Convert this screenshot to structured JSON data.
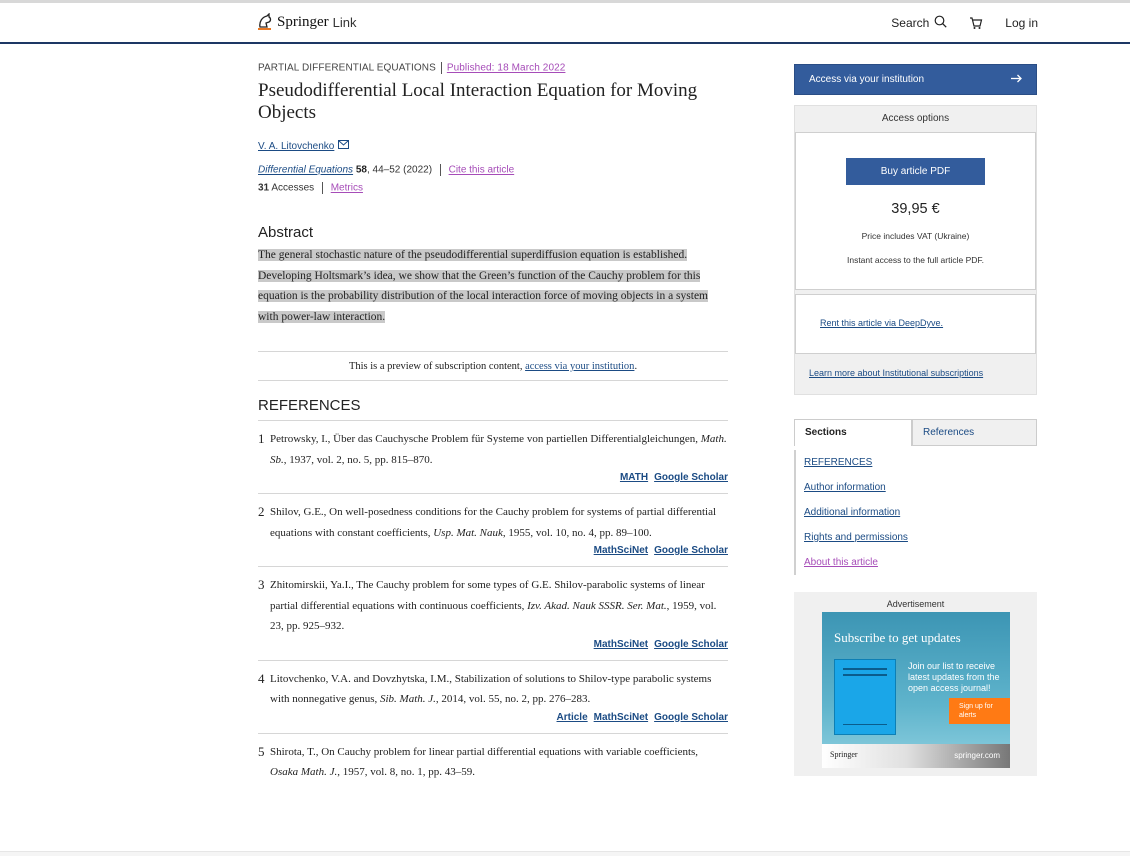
{
  "header": {
    "logo_text": "Springer",
    "logo_link": "Link",
    "search_label": "Search",
    "login_label": "Log in"
  },
  "article": {
    "section": "PARTIAL DIFFERENTIAL EQUATIONS",
    "published": "Published: 18 March 2022",
    "title": "Pseudodifferential Local Interaction Equation for Moving Objects",
    "author": "V. A. Litovchenko",
    "journal": "Differential Equations",
    "volume": "58",
    "pages": ", 44–52 (2022)",
    "cite": "Cite this article",
    "accesses_count": "31",
    "accesses_label": "Accesses",
    "metrics": "Metrics"
  },
  "abstract": {
    "heading": "Abstract",
    "text": "The general stochastic nature of the pseudodifferential superdiffusion equation is established. Developing Holtsmark’s idea, we show that the Green’s function of the Cauchy problem for this equation is the probability distribution of the local interaction force of moving objects in a system with power-law interaction."
  },
  "preview": {
    "prefix": "This is a preview of subscription content, ",
    "link": "access via your institution",
    "suffix": "."
  },
  "references": {
    "heading": "REFERENCES",
    "items": [
      {
        "num": "1",
        "pre": "Petrowsky, I., Über das Cauchysche Problem für Systeme von partiellen Differentialgleichungen, ",
        "source": "Math. Sb.",
        "post": ", 1937, vol. 2, no. 5, pp. 815–870.",
        "links": [
          "MATH",
          "Google Scholar"
        ]
      },
      {
        "num": "2",
        "pre": "Shilov, G.E., On well-posedness conditions for the Cauchy problem for systems of partial differential equations with constant coefficients, ",
        "source": "Usp. Mat. Nauk",
        "post": ", 1955, vol. 10, no. 4, pp. 89–100.",
        "links": [
          "MathSciNet",
          "Google Scholar"
        ]
      },
      {
        "num": "3",
        "pre": "Zhitomirskii, Ya.I., The Cauchy problem for some types of G.E. Shilov-parabolic systems of linear partial differential equations with continuous coefficients, ",
        "source": "Izv. Akad. Nauk SSSR. Ser. Mat.",
        "post": ", 1959, vol. 23, pp. 925–932.",
        "links": [
          "MathSciNet",
          "Google Scholar"
        ]
      },
      {
        "num": "4",
        "pre": "Litovchenko, V.A. and Dovzhytska, I.M., Stabilization of solutions to Shilov-type parabolic systems with nonnegative genus, ",
        "source": "Sib. Math. J.",
        "post": ", 2014, vol. 55, no. 2, pp. 276–283.",
        "links": [
          "Article",
          "MathSciNet",
          "Google Scholar"
        ]
      },
      {
        "num": "5",
        "pre": "Shirota, T., On Cauchy problem for linear partial differential equations with variable coefficients, ",
        "source": "Osaka Math. J.",
        "post": ", 1957, vol. 8, no. 1, pp. 43–59.",
        "links": []
      }
    ]
  },
  "sidebar": {
    "access_button": "Access via your institution",
    "access_options": "Access options",
    "buy_pdf": "Buy article PDF",
    "price": "39,95 €",
    "vat": "Price includes VAT (Ukraine)",
    "instant": "Instant access to the full article PDF.",
    "rent": "Rent this article via DeepDyve.",
    "learn_more": "Learn more about Institutional subscriptions",
    "tabs": [
      "Sections",
      "References"
    ],
    "sections": [
      "REFERENCES",
      "Author information",
      "Additional information",
      "Rights and permissions",
      "About this article"
    ]
  },
  "ad": {
    "label": "Advertisement",
    "title": "Subscribe to get updates",
    "body": "Join our list to receive latest updates from the open access journal!",
    "signup": "Sign up for alerts",
    "brand": "Springer",
    "url": "springer.com"
  },
  "colors": {
    "brand_blue": "#335c9c",
    "link_blue": "#1b4b84",
    "visited_purple": "#a64cb8",
    "highlight_gray": "#c9c9c9"
  }
}
